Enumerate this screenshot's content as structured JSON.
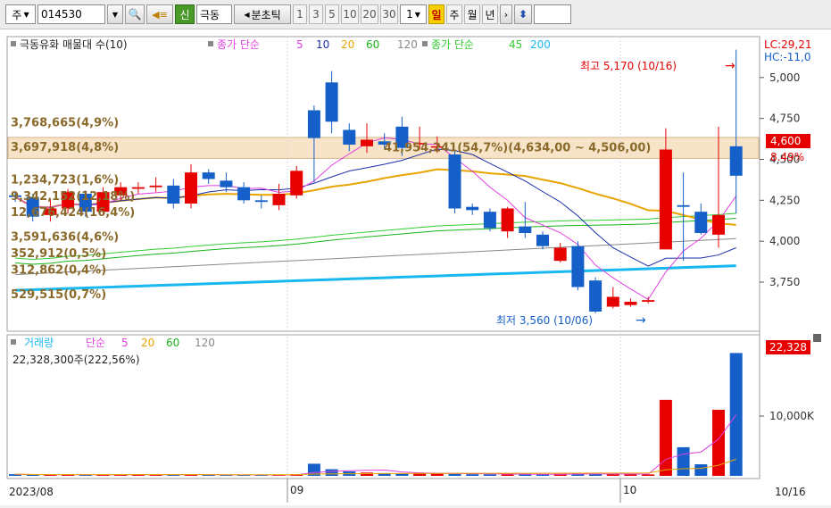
{
  "toolbar": {
    "market": "주",
    "code": "014530",
    "new_label": "신",
    "stock_name": "극동",
    "period_label": "분초틱",
    "minute_options": [
      "1",
      "3",
      "5",
      "10",
      "20",
      "30"
    ],
    "count": "1",
    "period_units": [
      "일",
      "주",
      "월",
      "년"
    ],
    "active_unit": "일"
  },
  "price_panel": {
    "legend": {
      "title": "극동유화 매물대 수(10)",
      "ma_title": "종가 단순",
      "ma_periods": [
        "5",
        "10",
        "20",
        "60",
        "120"
      ],
      "ma2_title": "종가 단순",
      "ma2_periods": [
        "45",
        "200"
      ]
    },
    "volume_profile": [
      {
        "label": "3,768,665(4,9%)",
        "price": 4725
      },
      {
        "label": "3,697,918(4,8%)",
        "price": 4575
      },
      {
        "label": "41,954,241(54,7%)(4,634,00 ~ 4,506,00)",
        "price": 4570
      },
      {
        "label": "1,234,723(1,6%)",
        "price": 4375
      },
      {
        "label": "9,342,152(12,18%)",
        "price": 4275
      },
      {
        "label": "12,676,424(16,4%)",
        "price": 4175
      },
      {
        "label": "3,591,636(4,6%)",
        "price": 4025
      },
      {
        "label": "352,912(0,5%)",
        "price": 3925
      },
      {
        "label": "312,862(0,4%)",
        "price": 3825
      },
      {
        "label": "529,515(0,7%)",
        "price": 3675
      }
    ],
    "high_label": "최고 5,170 (10/16)",
    "low_label": "최저 3,560 (10/06)",
    "lc_label": "LC:29,21",
    "hc_label": "HC:-11,0",
    "current_price": "4,600",
    "change_pct": "8.49%",
    "y_ticks": [
      "5,000",
      "4,750",
      "4,500",
      "4,250",
      "4,000",
      "3,750"
    ],
    "y_tick_values": [
      5000,
      4750,
      4500,
      4250,
      4000,
      3750
    ]
  },
  "volume_panel": {
    "legend_title": "거래량",
    "ma_title": "단순",
    "ma_periods": [
      "5",
      "20",
      "60",
      "120"
    ],
    "value_label": "22,328,300주(222,56%)",
    "right_value": "22,328",
    "right_pct": "222,56",
    "tick_label": "10,000K"
  },
  "x_axis": {
    "labels": [
      "2023/08",
      "09",
      "10",
      "10/16"
    ]
  },
  "colors": {
    "up": "#e60000",
    "down": "#1560c8",
    "ma5": "#e040e0",
    "ma10": "#1a2fa8",
    "ma20": "#e8a400",
    "ma60": "#19b319",
    "ma120": "#888888",
    "ma45": "#33cc33",
    "ma200": "#19b8f0"
  },
  "candles": [
    {
      "o": 4280,
      "c": 4270,
      "h": 4300,
      "l": 4240
    },
    {
      "o": 4270,
      "c": 4150,
      "h": 4290,
      "l": 4120
    },
    {
      "o": 4160,
      "c": 4200,
      "h": 4260,
      "l": 4120
    },
    {
      "o": 4200,
      "c": 4300,
      "h": 4320,
      "l": 4170
    },
    {
      "o": 4290,
      "c": 4180,
      "h": 4310,
      "l": 4150
    },
    {
      "o": 4180,
      "c": 4300,
      "h": 4330,
      "l": 4160
    },
    {
      "o": 4280,
      "c": 4330,
      "h": 4360,
      "l": 4250
    },
    {
      "o": 4320,
      "c": 4330,
      "h": 4360,
      "l": 4290
    },
    {
      "o": 4330,
      "c": 4340,
      "h": 4390,
      "l": 4300
    },
    {
      "o": 4340,
      "c": 4230,
      "h": 4380,
      "l": 4200
    },
    {
      "o": 4230,
      "c": 4420,
      "h": 4470,
      "l": 4200
    },
    {
      "o": 4420,
      "c": 4380,
      "h": 4440,
      "l": 4350
    },
    {
      "o": 4370,
      "c": 4330,
      "h": 4420,
      "l": 4300
    },
    {
      "o": 4330,
      "c": 4250,
      "h": 4360,
      "l": 4230
    },
    {
      "o": 4250,
      "c": 4240,
      "h": 4280,
      "l": 4200
    },
    {
      "o": 4220,
      "c": 4290,
      "h": 4350,
      "l": 4190
    },
    {
      "o": 4280,
      "c": 4430,
      "h": 4460,
      "l": 4260
    },
    {
      "o": 4800,
      "c": 4630,
      "h": 4830,
      "l": 4360
    },
    {
      "o": 4970,
      "c": 4730,
      "h": 5040,
      "l": 4660
    },
    {
      "o": 4680,
      "c": 4590,
      "h": 4720,
      "l": 4550
    },
    {
      "o": 4580,
      "c": 4620,
      "h": 4720,
      "l": 4540
    },
    {
      "o": 4610,
      "c": 4590,
      "h": 4660,
      "l": 4560
    },
    {
      "o": 4700,
      "c": 4570,
      "h": 4760,
      "l": 4520
    },
    {
      "o": 4600,
      "c": 4600,
      "h": 4700,
      "l": 4560
    },
    {
      "o": 4580,
      "c": 4580,
      "h": 4640,
      "l": 4540
    },
    {
      "o": 4530,
      "c": 4200,
      "h": 4560,
      "l": 4170
    },
    {
      "o": 4210,
      "c": 4190,
      "h": 4230,
      "l": 4160
    },
    {
      "o": 4180,
      "c": 4080,
      "h": 4200,
      "l": 4060
    },
    {
      "o": 4060,
      "c": 4200,
      "h": 4210,
      "l": 4020
    },
    {
      "o": 4090,
      "c": 4050,
      "h": 4240,
      "l": 4020
    },
    {
      "o": 4040,
      "c": 3970,
      "h": 4060,
      "l": 3950
    },
    {
      "o": 3880,
      "c": 3960,
      "h": 3990,
      "l": 3870
    },
    {
      "o": 3970,
      "c": 3720,
      "h": 4000,
      "l": 3700
    },
    {
      "o": 3760,
      "c": 3570,
      "h": 3780,
      "l": 3560
    },
    {
      "o": 3600,
      "c": 3660,
      "h": 3720,
      "l": 3590
    },
    {
      "o": 3610,
      "c": 3630,
      "h": 3650,
      "l": 3600
    },
    {
      "o": 3630,
      "c": 3640,
      "h": 3660,
      "l": 3620
    },
    {
      "o": 3950,
      "c": 4560,
      "h": 4690,
      "l": 3950
    },
    {
      "o": 4220,
      "c": 4210,
      "h": 4420,
      "l": 3880
    },
    {
      "o": 4180,
      "c": 4050,
      "h": 4230,
      "l": 4040
    },
    {
      "o": 4040,
      "c": 4160,
      "h": 4700,
      "l": 3960
    },
    {
      "o": 4580,
      "c": 4400,
      "h": 5170,
      "l": 4170
    }
  ],
  "volumes": [
    300,
    200,
    150,
    250,
    180,
    220,
    200,
    300,
    150,
    200,
    250,
    180,
    160,
    150,
    140,
    200,
    300,
    2200,
    1200,
    800,
    600,
    500,
    400,
    450,
    400,
    350,
    300,
    280,
    250,
    300,
    280,
    350,
    400,
    350,
    300,
    250,
    260,
    13800,
    5200,
    2100,
    12000,
    22300
  ]
}
